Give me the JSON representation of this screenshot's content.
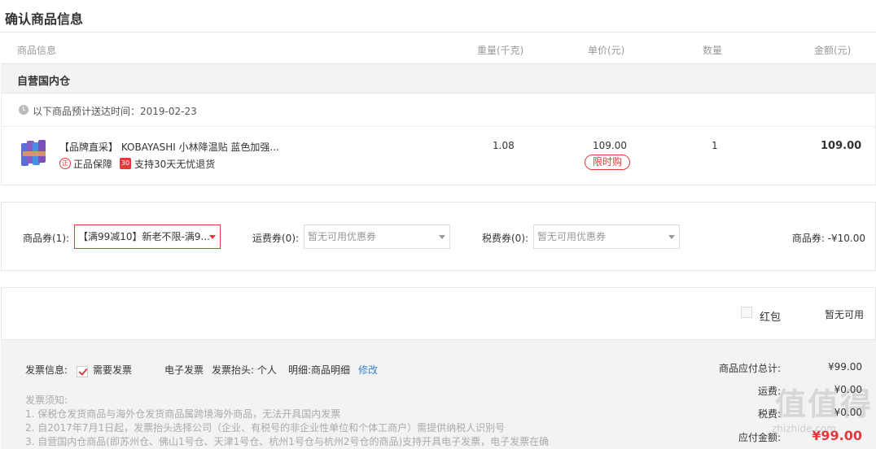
{
  "page": {
    "title": "确认商品信息"
  },
  "columns": {
    "info": "商品信息",
    "weight": "重量(千克)",
    "price": "单价(元)",
    "qty": "数量",
    "amount": "金额(元)"
  },
  "warehouse": {
    "name": "自营国内仓"
  },
  "delivery": {
    "text": "以下商品预计送达时间：2019-02-23"
  },
  "product": {
    "title": "【品牌直采】 KOBAYASHI 小林降温贴 蓝色加强...",
    "genuine_icon": "正",
    "genuine": "正品保障",
    "return_icon": "30",
    "return_policy": "支持30天无忧退货",
    "weight": "1.08",
    "price": "109.00",
    "limit_badge": "限时购",
    "qty": "1",
    "amount": "109.00"
  },
  "coupons": {
    "goods_label": "商品券(1):",
    "goods_value": "【满99减10】新老不限-满9...",
    "shipping_label": "运费券(0):",
    "shipping_value": "暂无可用优惠券",
    "tax_label": "税费券(0):",
    "tax_value": "暂无可用优惠券",
    "discount": "商品券: -¥10.00"
  },
  "redpack": {
    "label": "红包",
    "status": "暂无可用"
  },
  "invoice": {
    "label": "发票信息:",
    "need": "需要发票",
    "type": "电子发票",
    "head": "发票抬头: 个人",
    "detail": "明细:商品明细",
    "edit": "修改"
  },
  "notice": {
    "title": "发票须知:",
    "lines": [
      "1. 保税仓发货商品与海外仓发货商品属跨境海外商品，无法开具国内发票",
      "2. 自2017年7月1日起，发票抬头选择公司（企业、有税号的非企业性单位和个体工商户）需提供纳税人识别号",
      "3. 自营国内仓商品(即苏州仓、佛山1号仓、天津1号仓、杭州1号仓与杭州2号仓的商品)支持开具电子发票，电子发票在确"
    ]
  },
  "summary": {
    "subtotal_label": "商品应付总计:",
    "subtotal": "¥99.00",
    "shipping_label": "运费:",
    "shipping": "¥0.00",
    "tax_label": "税费:",
    "tax": "¥0.00",
    "total_label": "应付金额:",
    "total": "¥99.00"
  },
  "watermark": {
    "text": "值值得",
    "sub": "zhizhide.com"
  },
  "colors": {
    "accent": "#e4393c",
    "link": "#3a86c8",
    "panel_bg": "#f3f3f3"
  }
}
